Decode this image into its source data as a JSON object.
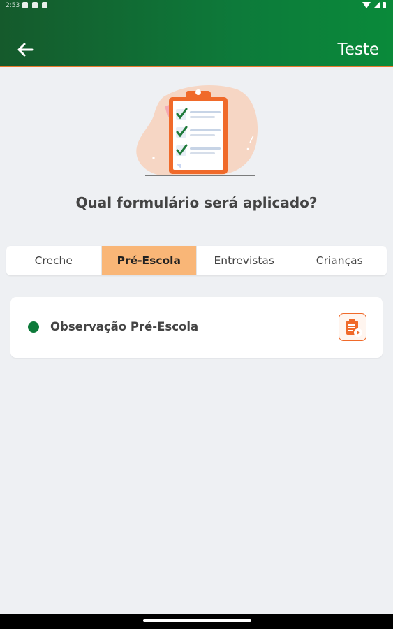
{
  "status_bar": {
    "time": "2:53"
  },
  "app_bar": {
    "title": "Teste"
  },
  "question": "Qual formulário será aplicado?",
  "tabs": [
    {
      "label": "Creche",
      "active": false
    },
    {
      "label": "Pré-Escola",
      "active": true
    },
    {
      "label": "Entrevistas",
      "active": false
    },
    {
      "label": "Crianças",
      "active": false
    }
  ],
  "forms": [
    {
      "label": "Observação Pré-Escola",
      "status_color": "#0d7a3a",
      "action_icon": "clipboard-play-icon"
    }
  ],
  "colors": {
    "header_green": "#0d7a3a",
    "accent_orange": "#f06a2a",
    "active_tab": "#f9b677",
    "background": "#eef0f3"
  }
}
